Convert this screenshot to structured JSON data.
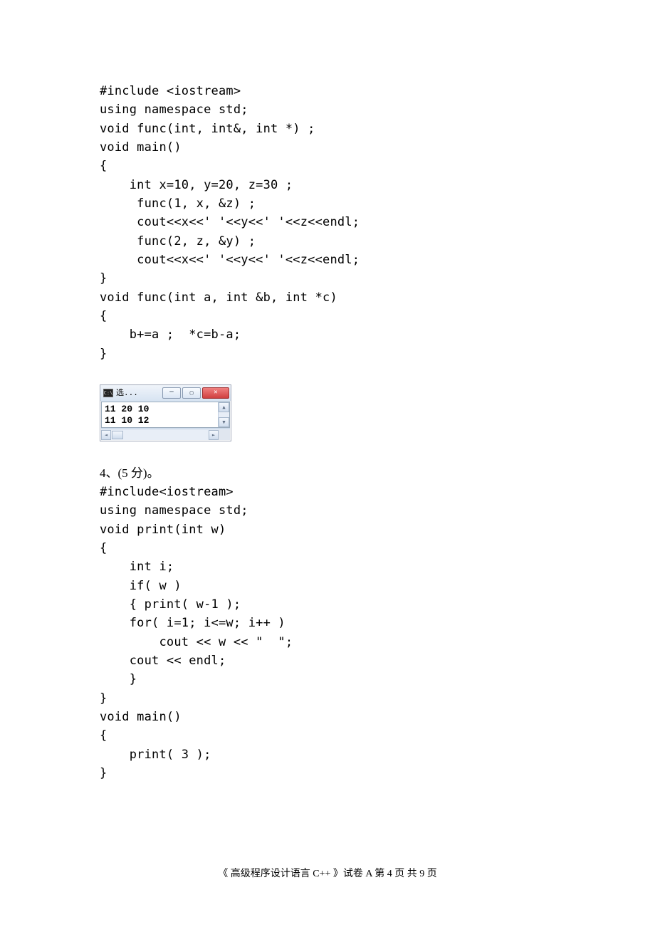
{
  "code1": "#include <iostream>\nusing namespace std;\nvoid func(int, int&, int *) ;\nvoid main()\n{\n    int x=10, y=20, z=30 ;\n     func(1, x, &z) ;\n     cout<<x<<' '<<y<<' '<<z<<endl;\n     func(2, z, &y) ;\n     cout<<x<<' '<<y<<' '<<z<<endl;\n}\nvoid func(int a, int &b, int *c)\n{\n    b+=a ;  *c=b-a;\n}",
  "console": {
    "icon_text": "C:\\",
    "title": "选...",
    "lines": "11 20 10\n11 10 12"
  },
  "q4_heading": "4、(5 分)。",
  "code2": "#include<iostream>\nusing namespace std;\nvoid print(int w)\n{\n    int i;\n    if( w )\n    { print( w-1 );\n    for( i=1; i<=w; i++ )\n        cout << w << \"  \";\n    cout << endl;\n    }\n}\nvoid main()\n{\n    print( 3 );\n}",
  "footer": "《 高级程序设计语言 C++ 》试卷 A 第 4 页 共 9 页"
}
